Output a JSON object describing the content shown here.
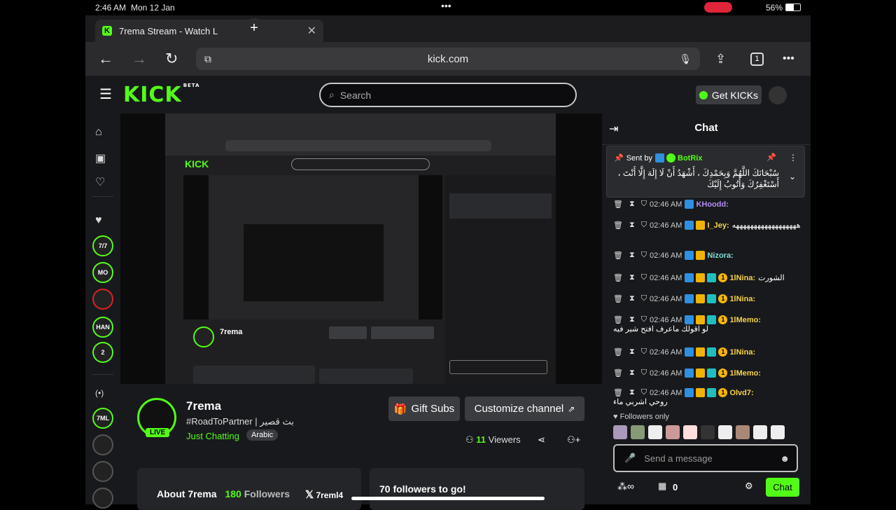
{
  "status": {
    "time": "2:46 AM",
    "date": "Mon 12 Jan",
    "battery": "56%"
  },
  "browser": {
    "tab_title": "7rema Stream - Watch L",
    "url": "kick.com",
    "tab_count": "1"
  },
  "header": {
    "logo": "KICK",
    "logo_sup": "BETA",
    "search_placeholder": "Search",
    "get_kicks": "Get KICKs"
  },
  "channel": {
    "name": "7rema",
    "title": "#RoadToPartner | بث قصير",
    "category": "Just Chatting",
    "tag": "Arabic",
    "live": "LIVE",
    "gift_subs": "Gift Subs",
    "customize": "Customize channel",
    "viewers": "11",
    "viewers_label": "Viewers",
    "about": "About 7rema",
    "followers": "180",
    "followers_label": "Followers",
    "x_handle": "7reml4",
    "goal": "70 followers to go!"
  },
  "sidebar": {
    "avatars": [
      "7/7",
      "MO",
      "",
      "HAN",
      "2",
      "7ML",
      "",
      "",
      ""
    ]
  },
  "chat": {
    "title": "Chat",
    "pinned_sent_by": "Sent by",
    "pinned_user": "BotRix",
    "pinned_text": "سُبْحَانَكَ اللَّهُمَّ وَبِحَمْدِكَ ، أَشْهَدُ أَنْ لَا إِلَهَ إِلَّا أَنْتَ ، أَسْتَغْفِرُكَ وَأَتُوبُ إِلَيْكَ",
    "messages": [
      {
        "time": "02:46 AM",
        "user": "KHoodd:",
        "color": "#b58cf5",
        "text": ""
      },
      {
        "time": "02:46 AM",
        "user": "I_Jey:",
        "color": "#f5d24a",
        "text": "ههههههههههههههههههه"
      },
      {
        "time": "02:46 AM",
        "user": "Nizora:",
        "color": "#7fdbd4",
        "text": ""
      },
      {
        "time": "02:46 AM",
        "user": "1lNina:",
        "color": "#f5d24a",
        "text": "الشورت"
      },
      {
        "time": "02:46 AM",
        "user": "1lNina:",
        "color": "#f5d24a",
        "text": ""
      },
      {
        "time": "02:46 AM",
        "user": "1lMemo:",
        "color": "#f5d24a",
        "text": "لو اقولك ماعرف افتح شير فيه"
      },
      {
        "time": "02:46 AM",
        "user": "1lNina:",
        "color": "#f5d24a",
        "text": ""
      },
      {
        "time": "02:46 AM",
        "user": "1lMemo:",
        "color": "#f5d24a",
        "text": ""
      },
      {
        "time": "02:46 AM",
        "user": "Olvd7:",
        "color": "#f5d24a",
        "text": "روحي اشربي ماء"
      }
    ],
    "followers_only": "Followers only",
    "send_placeholder": "Send a message",
    "points": "0",
    "chat_button": "Chat"
  },
  "colors": {
    "accent": "#53fc18",
    "bg": "#18191c"
  }
}
